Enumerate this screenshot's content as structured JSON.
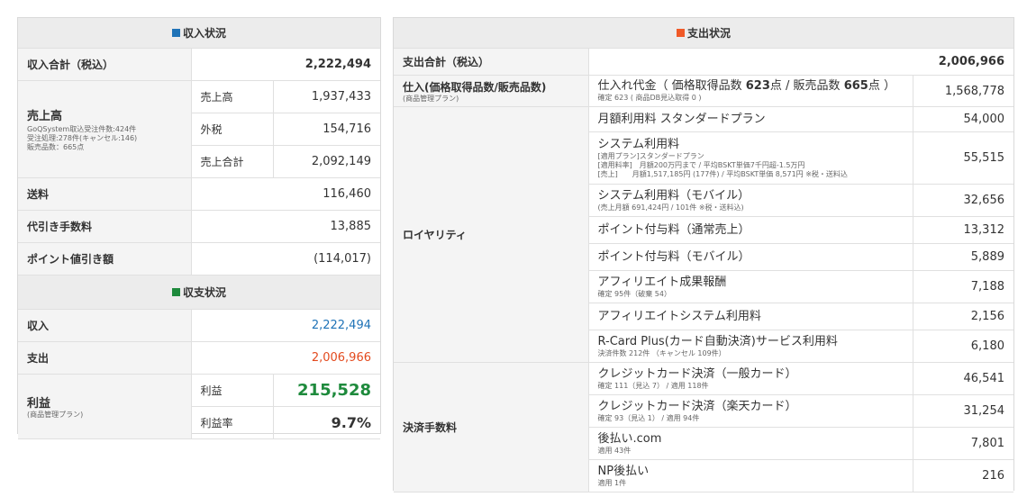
{
  "income": {
    "title": "収入状況",
    "icon_color": "#1f73b7",
    "total_label": "収入合計（税込）",
    "total_value": "2,222,494",
    "sales": {
      "label": "売上高",
      "note1": "GoQSystem取込受注件数:424件",
      "note2": "受注処理:278件(キャンセル:146)",
      "note3": "販売品数：665点",
      "rows": [
        {
          "label": "売上高",
          "value": "1,937,433"
        },
        {
          "label": "外税",
          "value": "154,716"
        },
        {
          "label": "売上合計",
          "value": "2,092,149"
        }
      ]
    },
    "other": [
      {
        "label": "送料",
        "value": "116,460"
      },
      {
        "label": "代引き手数料",
        "value": "13,885"
      },
      {
        "label": "ポイント値引き額",
        "value": "(114,017)"
      }
    ]
  },
  "balance": {
    "title": "収支状況",
    "icon_color": "#1e8a3c",
    "income_label": "収入",
    "income_value": "2,222,494",
    "expense_label": "支出",
    "expense_value": "2,006,966",
    "profit_label": "利益",
    "profit_note": "(商品管理プラン)",
    "profit_sub_label": "利益",
    "profit_value": "215,528",
    "rate_label": "利益率",
    "rate_value": "9.7%"
  },
  "expense": {
    "title": "支出状況",
    "icon_color": "#f05a28",
    "total_label": "支出合計（税込）",
    "total_value": "2,006,966",
    "purchase": {
      "label": "仕入(価格取得品数/販売品数)",
      "note": "(商品管理プラン)",
      "desc_pre": "仕入れ代金（ 価格取得品数 ",
      "desc_b1": "623",
      "desc_mid": "点 / 販売品数 ",
      "desc_b2": "665",
      "desc_post": "点 ）",
      "sub": "確定 623 ( 商品DB見込取得 0 )",
      "value": "1,568,778"
    },
    "royalty": {
      "label": "ロイヤリティ",
      "rows": [
        {
          "desc": "月額利用料 スタンダードプラン",
          "value": "54,000"
        },
        {
          "desc": "システム利用料",
          "sub1": "[適用プラン]スタンダードプラン",
          "sub2": "[適用料率]　月額200万円まで / 平均BSKT単価7千円超-1.5万円",
          "sub3": "[売上]　　月額1,517,185円 (177件) / 平均BSKT単価 8,571円 ※税・送料込",
          "value": "55,515"
        },
        {
          "desc": "システム利用料（モバイル）",
          "sub1": "(売上月額 691,424円 / 101件 ※税・送料込)",
          "value": "32,656"
        },
        {
          "desc": "ポイント付与料（通常売上）",
          "value": "13,312"
        },
        {
          "desc": "ポイント付与料（モバイル）",
          "value": "5,889"
        },
        {
          "desc": "アフィリエイト成果報酬",
          "sub1": "確定 95件（破棄 54）",
          "value": "7,188"
        },
        {
          "desc": "アフィリエイトシステム利用料",
          "value": "2,156"
        },
        {
          "desc": "R-Card Plus(カード自動決済)サービス利用料",
          "sub1": "決済件数 212件 （キャンセル 109件）",
          "value": "6,180"
        }
      ]
    },
    "payment": {
      "label": "決済手数料",
      "rows": [
        {
          "desc": "クレジットカード決済（一般カード）",
          "sub1": "確定 111（見込 7） / 適用 118件",
          "value": "46,541"
        },
        {
          "desc": "クレジットカード決済（楽天カード）",
          "sub1": "確定 93（見込 1） / 適用 94件",
          "value": "31,254"
        },
        {
          "desc": "後払い.com",
          "sub1": "適用 43件",
          "value": "7,801"
        },
        {
          "desc": "NP後払い",
          "sub1": "適用 1件",
          "value": "216"
        }
      ]
    }
  }
}
